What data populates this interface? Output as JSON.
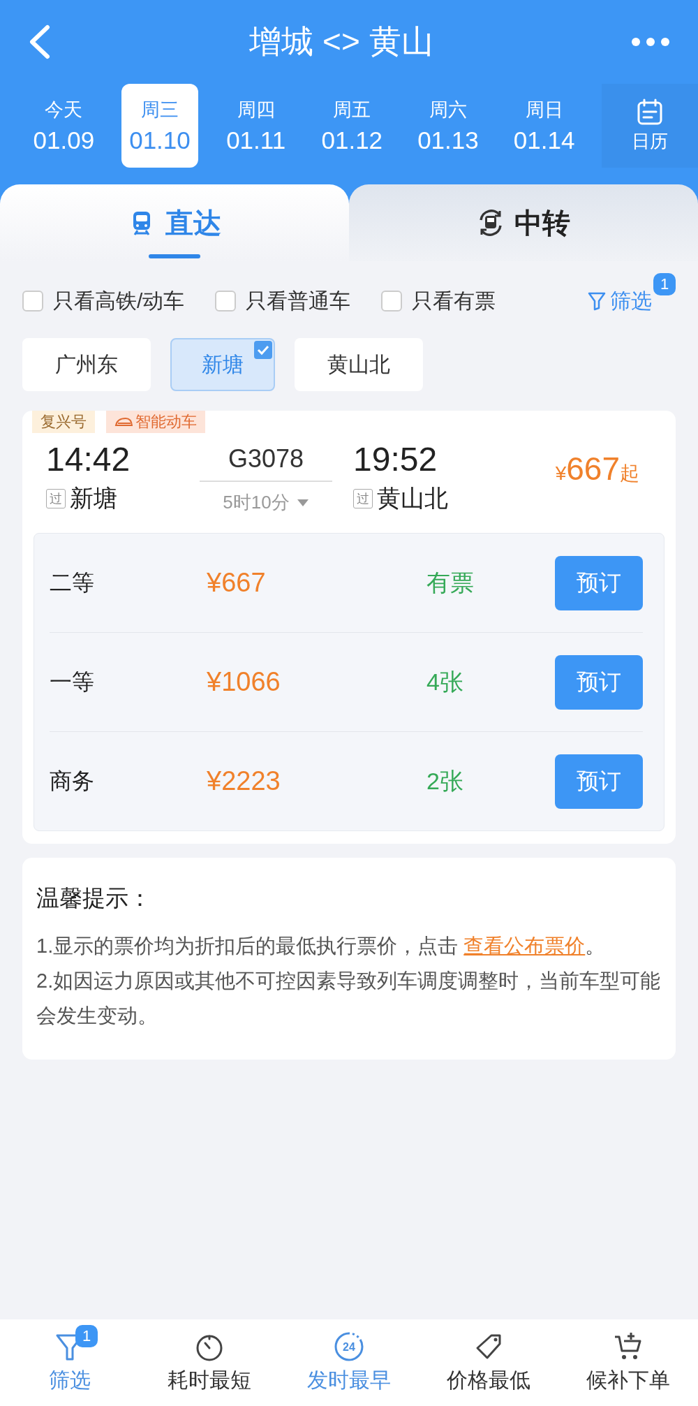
{
  "header": {
    "title": "增城 <> 黄山"
  },
  "dates": [
    {
      "weekday": "今天",
      "date": "01.09",
      "selected": false
    },
    {
      "weekday": "周三",
      "date": "01.10",
      "selected": true
    },
    {
      "weekday": "周四",
      "date": "01.11",
      "selected": false
    },
    {
      "weekday": "周五",
      "date": "01.12",
      "selected": false
    },
    {
      "weekday": "周六",
      "date": "01.13",
      "selected": false
    },
    {
      "weekday": "周日",
      "date": "01.14",
      "selected": false
    }
  ],
  "calendar": {
    "label": "日历"
  },
  "tabs": [
    {
      "label": "直达",
      "kind": "direct",
      "selected": true
    },
    {
      "label": "中转",
      "kind": "transfer",
      "selected": false
    }
  ],
  "filters": [
    {
      "label": "只看高铁/动车",
      "checked": false
    },
    {
      "label": "只看普通车",
      "checked": false
    },
    {
      "label": "只看有票",
      "checked": false
    }
  ],
  "filter_button": {
    "label": "筛选",
    "badge": "1"
  },
  "stations": [
    {
      "label": "广州东",
      "selected": false
    },
    {
      "label": "新塘",
      "selected": true
    },
    {
      "label": "黄山北",
      "selected": false
    }
  ],
  "train": {
    "tags": [
      {
        "label": "复兴号",
        "kind": "plain"
      },
      {
        "label": "智能动车",
        "kind": "smart"
      }
    ],
    "depart_time": "14:42",
    "depart_mark": "过",
    "depart_station": "新塘",
    "number": "G3078",
    "duration": "5时10分",
    "arrive_time": "19:52",
    "arrive_mark": "过",
    "arrive_station": "黄山北",
    "price_symbol": "¥",
    "price": "667",
    "price_suffix": "起",
    "seats": [
      {
        "class": "二等",
        "price": "¥667",
        "availability": "有票",
        "action": "预订"
      },
      {
        "class": "一等",
        "price": "¥1066",
        "availability": "4张",
        "action": "预订"
      },
      {
        "class": "商务",
        "price": "¥2223",
        "availability": "2张",
        "action": "预订"
      }
    ]
  },
  "tips": {
    "title": "温馨提示：",
    "items": [
      {
        "text": "1.显示的票价均为折扣后的最低执行票价，点击 ",
        "link": "查看公布票价",
        "after": "。"
      },
      {
        "text": "2.如因运力原因或其他不可控因素导致列车调度调整时，当前车型可能会发生变动。"
      }
    ]
  },
  "bottom_nav": [
    {
      "label": "筛选",
      "kind": "filter",
      "badge": "1",
      "selected": true
    },
    {
      "label": "耗时最短",
      "kind": "timer",
      "selected": false
    },
    {
      "label": "发时最早",
      "kind": "clock24",
      "icon_text": "24",
      "selected": true
    },
    {
      "label": "价格最低",
      "kind": "tag",
      "selected": false
    },
    {
      "label": "候补下单",
      "kind": "cart",
      "selected": false
    }
  ]
}
